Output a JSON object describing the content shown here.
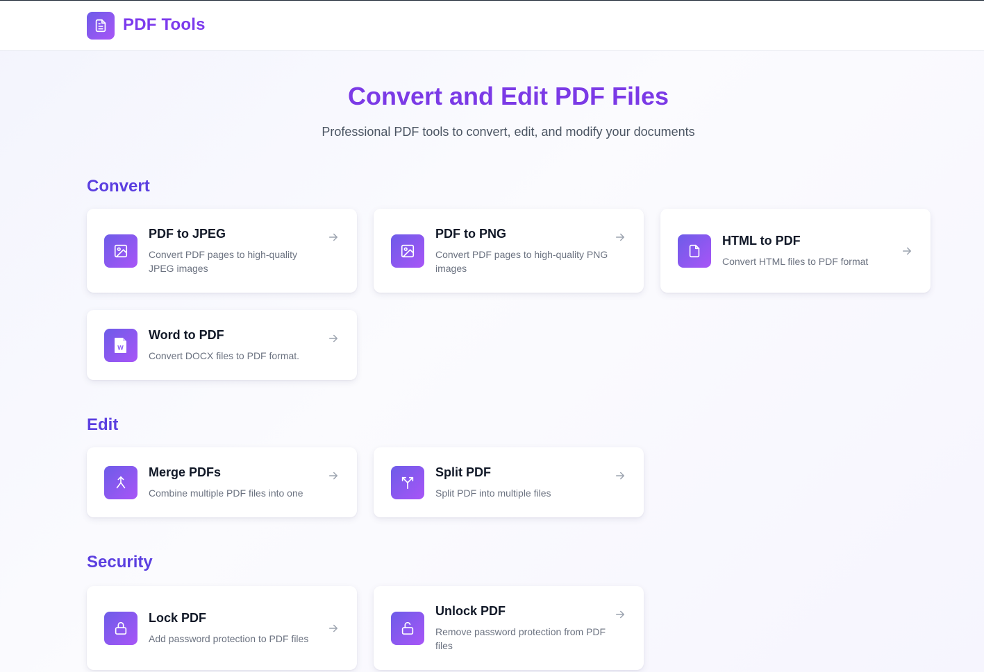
{
  "app": {
    "name": "PDF Tools",
    "logo_icon": "document-icon"
  },
  "hero": {
    "title": "Convert and Edit PDF Files",
    "subtitle": "Professional PDF tools to convert, edit, and modify your documents"
  },
  "sections": {
    "convert": {
      "title": "Convert",
      "tools": [
        {
          "title": "PDF to JPEG",
          "desc": "Convert PDF pages to high-quality JPEG images",
          "icon": "image-icon"
        },
        {
          "title": "PDF to PNG",
          "desc": "Convert PDF pages to high-quality PNG images",
          "icon": "image-icon"
        },
        {
          "title": "HTML to PDF",
          "desc": "Convert HTML files to PDF format",
          "icon": "file-icon"
        },
        {
          "title": "Word to PDF",
          "desc": "Convert DOCX files to PDF format.",
          "icon": "word-file-icon"
        }
      ]
    },
    "edit": {
      "title": "Edit",
      "tools": [
        {
          "title": "Merge PDFs",
          "desc": "Combine multiple PDF files into one",
          "icon": "merge-icon"
        },
        {
          "title": "Split PDF",
          "desc": "Split PDF into multiple files",
          "icon": "split-icon"
        }
      ]
    },
    "security": {
      "title": "Security",
      "tools": [
        {
          "title": "Lock PDF",
          "desc": "Add password protection to PDF files",
          "icon": "lock-icon"
        },
        {
          "title": "Unlock PDF",
          "desc": "Remove password protection from PDF files",
          "icon": "unlock-icon"
        }
      ]
    }
  },
  "theme": {
    "brand": "#7c3aed",
    "section_title": "#5b3fe0",
    "icon_gradient_start": "#6d5ce8",
    "icon_gradient_end": "#a855f7"
  }
}
